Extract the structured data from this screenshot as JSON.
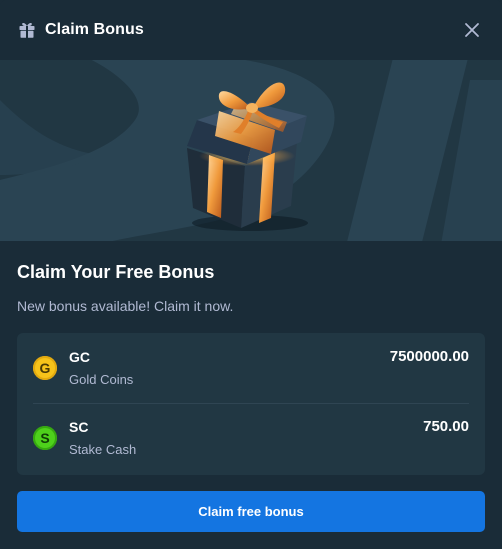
{
  "header": {
    "title": "Claim Bonus",
    "icon": "gift-icon",
    "close_icon": "close-icon"
  },
  "banner": {
    "image": "gift-box-illustration"
  },
  "main": {
    "heading": "Claim Your Free Bonus",
    "subtext": "New bonus available! Claim it now."
  },
  "balances": [
    {
      "symbol": "G",
      "code": "GC",
      "name": "Gold Coins",
      "amount": "7500000.00",
      "color": "#f7c31a"
    },
    {
      "symbol": "S",
      "code": "SC",
      "name": "Stake Cash",
      "amount": "750.00",
      "color": "#4ed11b"
    }
  ],
  "actions": {
    "claim_label": "Claim free bonus"
  },
  "colors": {
    "background": "#1a2c38",
    "card": "#213743",
    "accent": "#1475e1",
    "muted_text": "#b1bad3"
  }
}
